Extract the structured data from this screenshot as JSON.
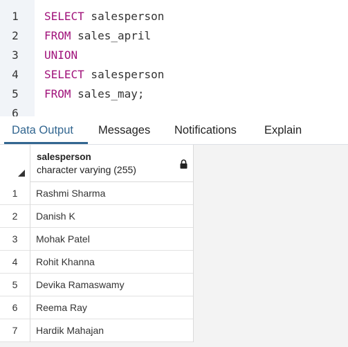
{
  "editor": {
    "lines": [
      {
        "no": "1",
        "keyword": "SELECT",
        "rest": " salesperson"
      },
      {
        "no": "2",
        "keyword": "FROM",
        "rest": " sales_april"
      },
      {
        "no": "3",
        "keyword": "UNION",
        "rest": ""
      },
      {
        "no": "4",
        "keyword": "SELECT",
        "rest": " salesperson"
      },
      {
        "no": "5",
        "keyword": "FROM",
        "rest": " sales_may;"
      },
      {
        "no": "6",
        "keyword": "",
        "rest": ""
      }
    ]
  },
  "tabs": [
    {
      "label": "Data Output",
      "active": true
    },
    {
      "label": "Messages",
      "active": false
    },
    {
      "label": "Notifications",
      "active": false
    },
    {
      "label": "Explain",
      "active": false
    }
  ],
  "grid": {
    "column": {
      "name": "salesperson",
      "type": "character varying (255)",
      "icon": "lock-icon"
    },
    "rows": [
      {
        "num": "1",
        "value": "Rashmi Sharma"
      },
      {
        "num": "2",
        "value": "Danish K"
      },
      {
        "num": "3",
        "value": "Mohak Patel"
      },
      {
        "num": "4",
        "value": "Rohit Khanna"
      },
      {
        "num": "5",
        "value": "Devika Ramaswamy"
      },
      {
        "num": "6",
        "value": "Reema Ray"
      },
      {
        "num": "7",
        "value": "Hardik Mahajan"
      }
    ]
  },
  "colors": {
    "keyword": "#a0117a",
    "active_tab": "#326690"
  }
}
